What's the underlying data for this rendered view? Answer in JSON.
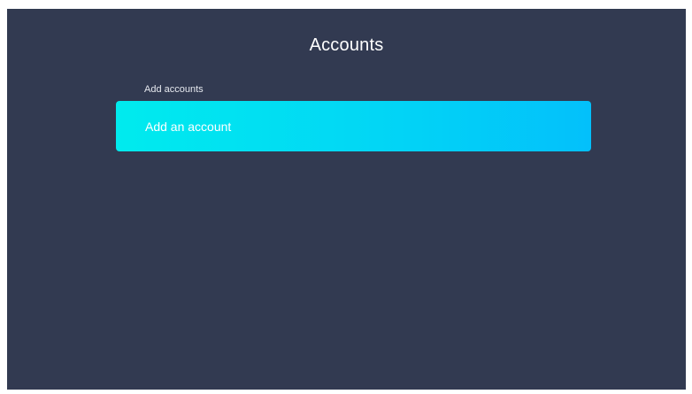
{
  "header": {
    "title": "Accounts"
  },
  "accounts": {
    "section_label": "Add accounts",
    "add_account_label": "Add an account"
  },
  "colors": {
    "background": "#323a51",
    "item_gradient_start": "#00ebee",
    "item_gradient_end": "#03c0fb"
  }
}
